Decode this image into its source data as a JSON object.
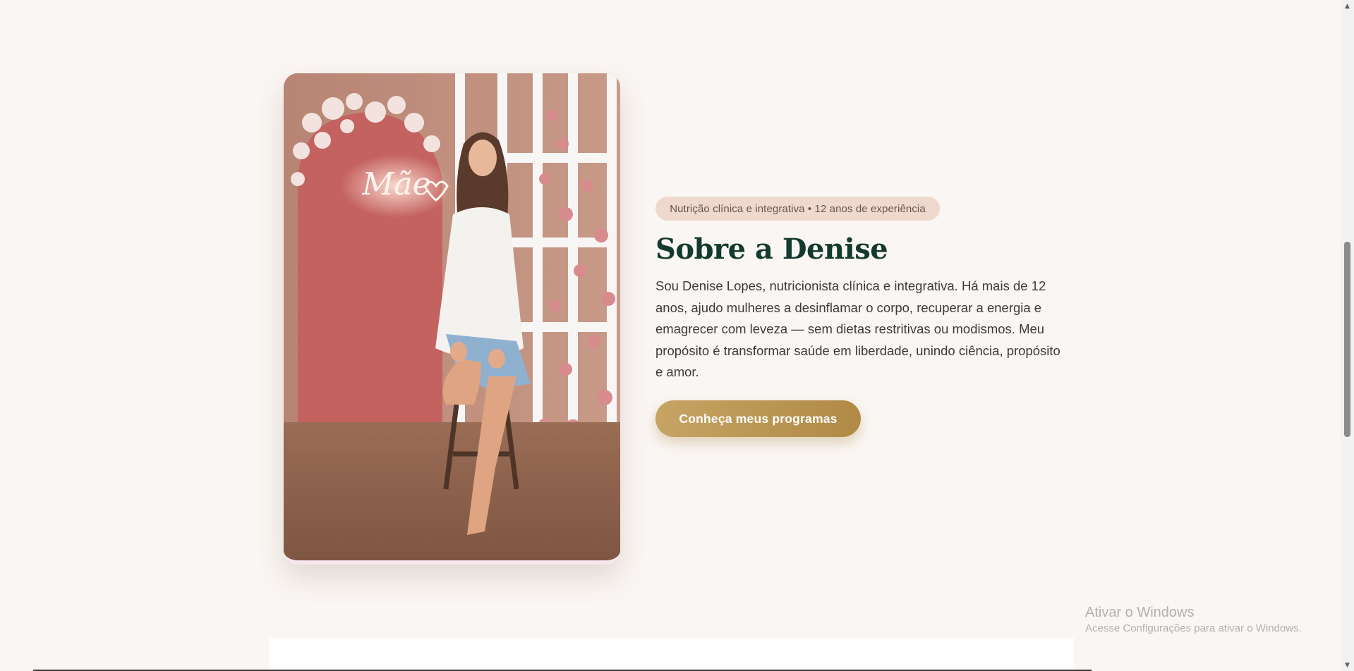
{
  "about": {
    "badge": "Nutrição clínica e integrativa • 12 anos de experiência",
    "heading": "Sobre a Denise",
    "bio": "Sou Denise Lopes, nutricionista clínica e integrativa. Há mais de 12 anos, ajudo mulheres a desinflamar o corpo, recuperar a energia e emagrecer com leveza — sem dietas restritivas ou modismos. Meu propósito é transformar saúde em liberdade, unindo ciência, propósito e amor.",
    "cta_label": "Conheça meus programas",
    "photo": {
      "neon_text": "Mãe",
      "icon": "neon-heart-icon"
    }
  },
  "windows_watermark": {
    "title": "Ativar o Windows",
    "subtitle": "Acesse Configurações para ativar o Windows."
  },
  "scrollbar": {
    "up_icon": "scroll-up-arrow-icon",
    "down_icon": "scroll-down-arrow-icon"
  },
  "colors": {
    "page_background": "#faf6f3",
    "heading": "#123a2f",
    "badge_background": "#efd9ce",
    "cta_gold": "#b8954f"
  }
}
